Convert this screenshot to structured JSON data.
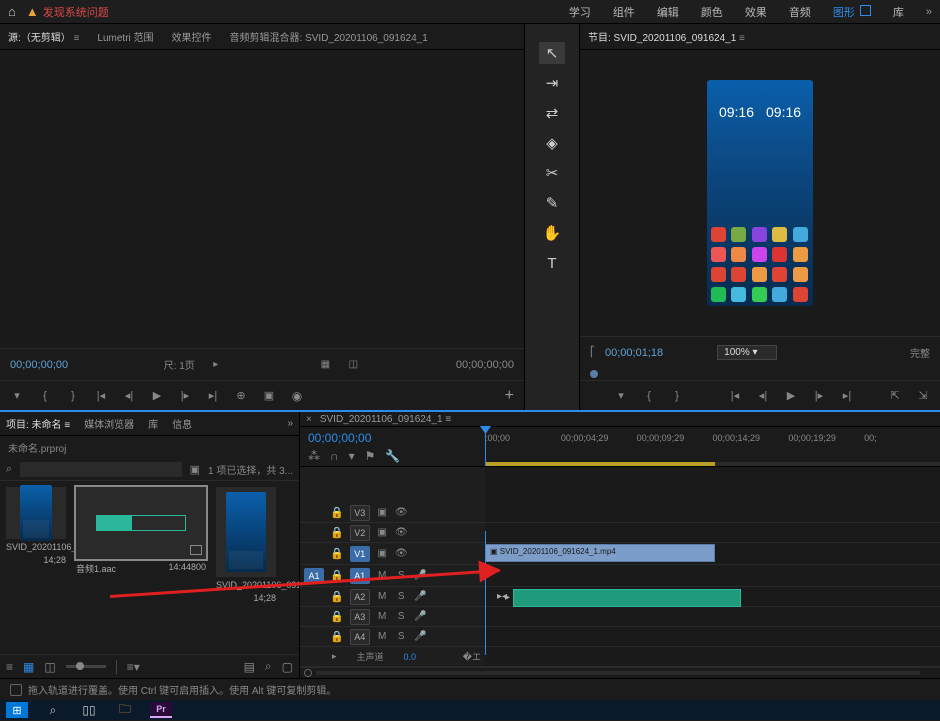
{
  "top_bar": {
    "warning_text": "发现系统问题",
    "menu": {
      "learn": "学习",
      "assembly": "组件",
      "editing": "编辑",
      "color": "颜色",
      "effects": "效果",
      "audio": "音频",
      "graphics": "图形",
      "library": "库"
    }
  },
  "source_panel": {
    "tabs": {
      "source": "源:（无剪辑）",
      "lumetri": "Lumetri 范围",
      "effect_controls": "效果控件",
      "audio_mixer": "音频剪辑混合器: SVID_20201106_091624_1"
    },
    "tc_left": "00;00;00;00",
    "fit_label": "尺: 1页",
    "tc_right": "00;00;00;00"
  },
  "program_panel": {
    "tab": "节目: SVID_20201106_091624_1",
    "phone_time_left": "09:16",
    "phone_time_right": "09:16",
    "tc": "00;00;01;18",
    "zoom": "100%",
    "full_label": "完整"
  },
  "project_panel": {
    "tabs": {
      "project": "项目: 未命名",
      "media_browser": "媒体浏览器",
      "libraries": "库",
      "info": "信息"
    },
    "file_name": "未命名.prproj",
    "search_placeholder": "",
    "selection_text": "1 项已选择，共 3...",
    "bins": [
      {
        "name": "SVID_20201106_0916...",
        "duration": "14;28"
      },
      {
        "name": "音频1.aac",
        "duration": "14:44800"
      },
      {
        "name": "SVID_20201106_0916...",
        "duration": "14;28"
      }
    ]
  },
  "timeline": {
    "tab": "SVID_20201106_091624_1",
    "tc": "00;00;00;00",
    "ruler_marks": [
      ":00;00",
      "00;00;04;29",
      "00;00;09;29",
      "00;00;14;29",
      "00;00;19;29",
      "00;"
    ],
    "tracks": {
      "v3": "V3",
      "v2": "V2",
      "v1": "V1",
      "a1_src": "A1",
      "a1": "A1",
      "a2": "A2",
      "a3": "A3",
      "a4": "A4",
      "btn_m": "M",
      "btn_s": "S",
      "mixer_label": "主声道",
      "mixer_value": "0.0"
    },
    "clips": {
      "video": "SVID_20201106_091624_1.mp4"
    }
  },
  "status_bar": {
    "text": "拖入轨道进行覆盖。使用 Ctrl 键可启用插入。使用 Alt 键可复制剪辑。"
  },
  "taskbar": {
    "pr": "Pr"
  }
}
